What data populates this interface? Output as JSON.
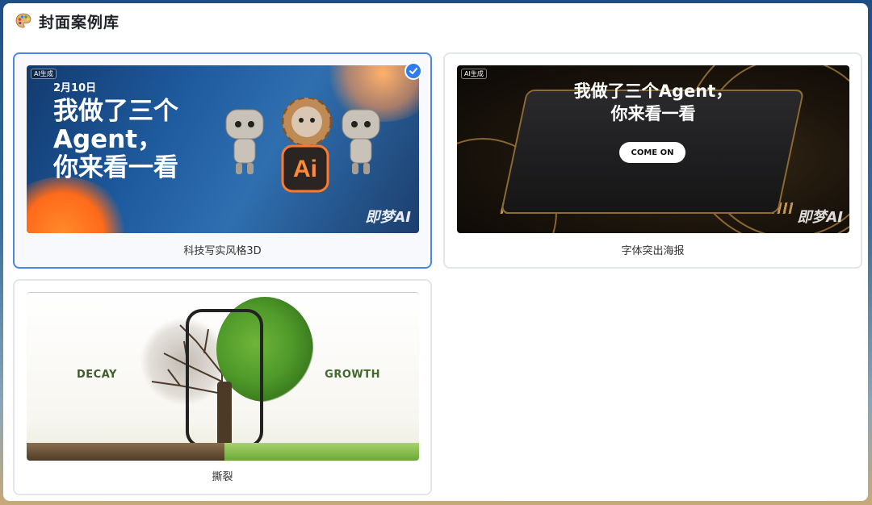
{
  "header": {
    "title": "封面案例库",
    "icon": "palette-icon"
  },
  "cards": [
    {
      "caption": "科技写实风格3D",
      "selected": true,
      "thumb": {
        "tag": "AI生成",
        "date": "2月10日",
        "headline_lines": [
          "我做了三个",
          "Agent，",
          "你来看一看"
        ],
        "brand": "即梦AI"
      }
    },
    {
      "caption": "字体突出海报",
      "selected": false,
      "thumb": {
        "tag": "AI生成",
        "headline_lines": [
          "我做了三个Agent，",
          "你来看一看"
        ],
        "button": "COME ON",
        "brand": "即梦AI"
      }
    },
    {
      "caption": "撕裂",
      "selected": false,
      "thumb": {
        "left_label": "DECAY",
        "right_label": "GROWTH"
      }
    }
  ],
  "colors": {
    "accent": "#2f7bf0",
    "selected_border": "#4a86e8"
  }
}
